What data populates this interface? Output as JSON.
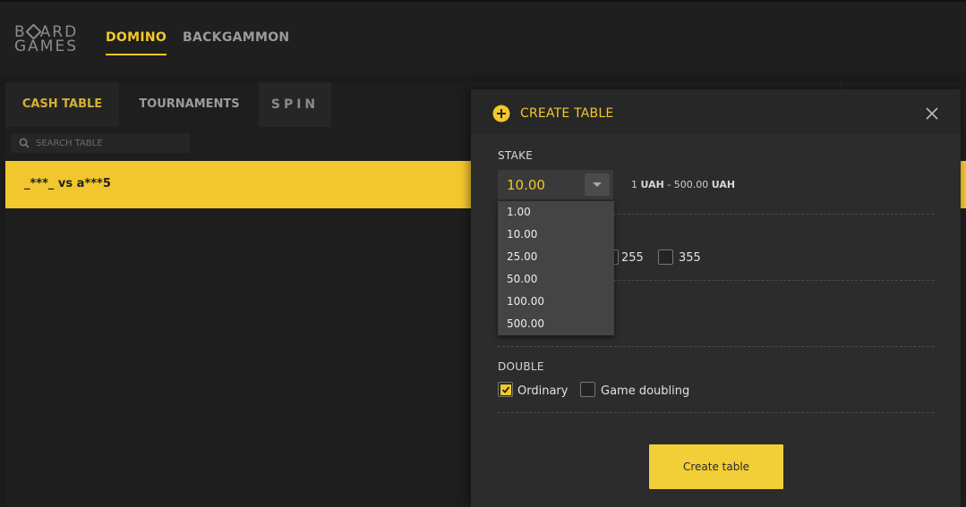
{
  "brand": {
    "line1": "BOARD",
    "line2": "GAMES"
  },
  "nav": {
    "items": [
      {
        "label": "DOMINO",
        "active": true
      },
      {
        "label": "BACKGAMMON",
        "active": false
      }
    ]
  },
  "tabs": [
    {
      "label": "CASH TABLE",
      "active": true
    },
    {
      "label": "TOURNAMENTS",
      "active": false
    },
    {
      "label": "SPIN",
      "active": false
    }
  ],
  "search": {
    "placeholder": "SEARCH TABLE",
    "value": ""
  },
  "tables": [
    {
      "label": "_***_ vs a***5"
    }
  ],
  "modal": {
    "title": "CREATE TABLE",
    "stake": {
      "label": "STAKE",
      "selected": "10.00",
      "range": {
        "min": "1",
        "currency": "UAH",
        "separator": " - ",
        "max": "500.00"
      },
      "options": [
        "1.00",
        "10.00",
        "25.00",
        "50.00",
        "100.00",
        "500.00"
      ]
    },
    "points": {
      "options": [
        {
          "label": "255",
          "checked": false
        },
        {
          "label": "355",
          "checked": false
        }
      ]
    },
    "double": {
      "label": "DOUBLE",
      "options": [
        {
          "label": "Ordinary",
          "checked": true
        },
        {
          "label": "Game doubling",
          "checked": false
        }
      ]
    },
    "create_label": "Create table"
  },
  "colors": {
    "accent": "#f1c92a",
    "background": "#1b1b1b",
    "modal": "#2c2c2c"
  }
}
